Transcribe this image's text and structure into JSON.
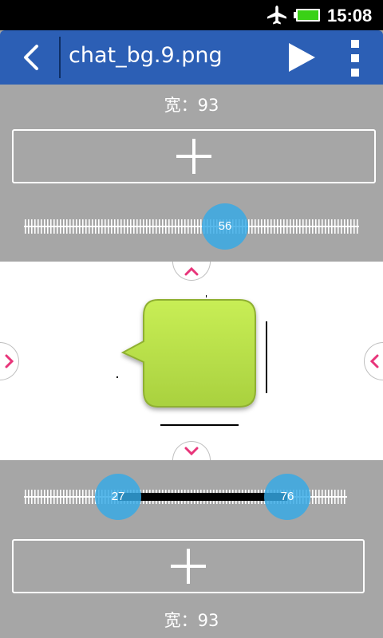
{
  "status_bar": {
    "time": "15:08",
    "icons": [
      "airplane-mode-icon",
      "battery-icon"
    ],
    "battery_color": "#3ad116"
  },
  "app_bar": {
    "title": "chat_bg.9.png",
    "icons": [
      "back-icon",
      "play-icon",
      "overflow-menu-icon"
    ],
    "color": "#2c5fb5"
  },
  "top_section": {
    "width_label": "宽：93",
    "add_icon": "plus-icon",
    "slider": {
      "value": 56,
      "value_label": "56"
    }
  },
  "preview": {
    "image": "chat-bubble-ninepatch",
    "bubble_color": "#bfe84f",
    "handles": [
      "arrow-up-icon",
      "arrow-down-icon",
      "arrow-left-icon",
      "arrow-right-icon"
    ],
    "handle_arrow_color": "#e8357a"
  },
  "bottom_section": {
    "range_slider": {
      "low": 27,
      "high": 76,
      "low_label": "27",
      "high_label": "76"
    },
    "add_icon": "plus-icon",
    "width_label": "宽：93"
  }
}
